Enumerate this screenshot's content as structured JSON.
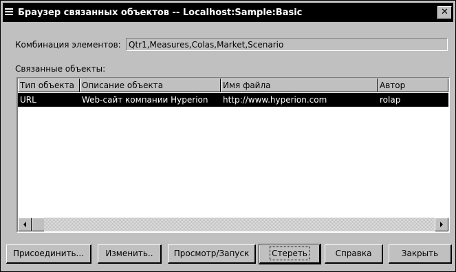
{
  "window": {
    "title": "Браузер связанных объектов  -- Localhost:Sample:Basic",
    "close_glyph": "✕"
  },
  "combination": {
    "label": "Комбинация элементов:",
    "value": "Qtr1,Measures,Colas,Market,Scenario"
  },
  "linked_objects": {
    "label": "Связанные объекты:",
    "columns": [
      "Тип объекта",
      "Описание объекта",
      "Имя файла",
      "Автор"
    ],
    "rows": [
      [
        "URL",
        "Web-сайт компании Hyperion",
        "http://www.hyperion.com",
        "rolap"
      ]
    ]
  },
  "scrollbar": {
    "left_glyph": "◀",
    "right_glyph": "▶",
    "position": 0
  },
  "buttons": {
    "attach": "Присоединить...",
    "edit": "Изменить..",
    "view": "Просмотр/Запуск",
    "delete": "Стереть",
    "help": "Справка",
    "close": "Закрыть"
  },
  "icons": {
    "system_menu": "system-menu-icon",
    "close": "close-icon",
    "scroll_left": "arrow-left-icon",
    "scroll_right": "arrow-right-icon"
  }
}
